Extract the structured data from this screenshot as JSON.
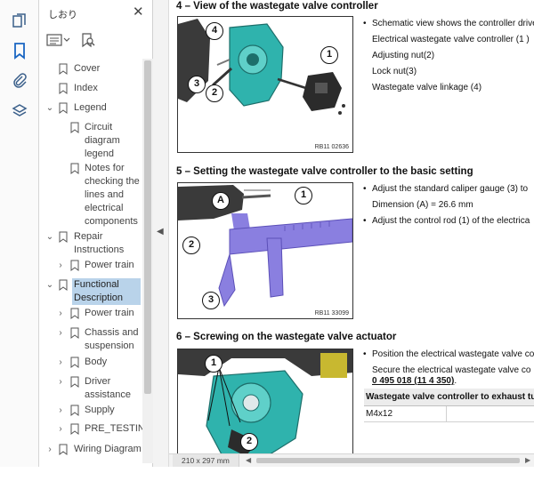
{
  "panel": {
    "title": "しおり",
    "close": "✕"
  },
  "bookmarks": [
    {
      "label": "Cover"
    },
    {
      "label": "Index"
    },
    {
      "label": "Legend",
      "twisty": "⌄"
    },
    {
      "label": "Circuit diagram legend"
    },
    {
      "label": "Notes for checking the lines and electrical components"
    },
    {
      "label": "Repair Instructions",
      "twisty": "⌄"
    },
    {
      "label": "Power train",
      "twisty": "›"
    },
    {
      "label": "Functional Description",
      "twisty": "⌄",
      "selected": true
    },
    {
      "label": "Power train",
      "twisty": "›"
    },
    {
      "label": "Chassis and suspension",
      "twisty": "›"
    },
    {
      "label": "Body",
      "twisty": "›"
    },
    {
      "label": "Driver assistance",
      "twisty": "›"
    },
    {
      "label": "Supply",
      "twisty": "›"
    },
    {
      "label": "PRE_TESTING",
      "twisty": "›"
    },
    {
      "label": "Wiring Diagram",
      "twisty": "›"
    }
  ],
  "sections": [
    {
      "title": "4 – View of the wastegate valve controller",
      "figure_ref": "RB11 02636",
      "callouts": [
        "4",
        "3",
        "2",
        "1"
      ],
      "lines": [
        "Schematic view shows the controller drive",
        "Electrical wastegate valve controller (1 )",
        "Adjusting nut(2)",
        "Lock nut(3)",
        "Wastegate valve linkage (4)"
      ]
    },
    {
      "title": "5 – Setting the wastegate valve controller to the basic setting",
      "figure_ref": "RB11 33099",
      "callouts": [
        "A",
        "1",
        "2",
        "3"
      ],
      "lines": [
        "Adjust the standard caliper gauge (3) to",
        "Dimension (A) = 26.6 mm",
        "Adjust the control rod (1) of the electrica"
      ]
    },
    {
      "title": "6 – Screwing on the wastegate valve actuator",
      "callouts": [
        "1",
        "2"
      ],
      "lines": [
        "Position the electrical wastegate valve co",
        "Secure the electrical wastegate valve co",
        "0 495 018 (11 4 350)",
        "."
      ],
      "table_header": "Wastegate valve controller to exhaust tu",
      "table_cell": "M4x12"
    }
  ],
  "status": {
    "page_size": "210 x 297 mm",
    "left_arrow": "◀",
    "right_arrow": "▶"
  },
  "collapse_arrow": "◀",
  "colors": {
    "accent": "#1a66c2",
    "selection": "#b9d3ea",
    "part_teal": "#2fb3ad",
    "caliper_violet": "#8a7fe0"
  }
}
